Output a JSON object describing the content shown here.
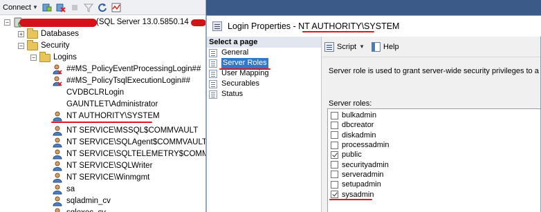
{
  "object_explorer": {
    "toolbar": {
      "connect_label": "Connect",
      "icons": [
        "connect-database-icon",
        "disconnect-icon",
        "stop-icon",
        "filter-icon",
        "refresh-icon",
        "activity-monitor-icon"
      ]
    },
    "server_node": {
      "label": "(SQL Server 13.0.5850.14 -",
      "expander": "−",
      "icon": "server-icon",
      "redacted": true
    },
    "databases_node": {
      "label": "Databases",
      "expander": "+"
    },
    "security_node": {
      "label": "Security",
      "expander": "−"
    },
    "logins_node": {
      "label": "Logins",
      "expander": "−"
    },
    "logins": [
      {
        "name": "##MS_PolicyEventProcessingLogin##",
        "icon": "disabled-login-icon"
      },
      {
        "name": "##MS_PolicyTsqlExecutionLogin##",
        "icon": "disabled-login-icon"
      },
      {
        "name": "CVDBCLRLogin",
        "icon": "none"
      },
      {
        "name": "GAUNTLET\\Administrator",
        "icon": "none"
      },
      {
        "name": "NT AUTHORITY\\SYSTEM",
        "icon": "login-icon"
      },
      {
        "name": "NT SERVICE\\MSSQL$COMMVAULT",
        "icon": "login-icon"
      },
      {
        "name": "NT SERVICE\\SQLAgent$COMMVAULT",
        "icon": "login-icon"
      },
      {
        "name": "NT SERVICE\\SQLTELEMETRY$COMMVAU",
        "icon": "login-icon"
      },
      {
        "name": "NT SERVICE\\SQLWriter",
        "icon": "login-icon"
      },
      {
        "name": "NT SERVICE\\Winmgmt",
        "icon": "login-icon"
      },
      {
        "name": "sa",
        "icon": "login-icon"
      },
      {
        "name": "sqladmin_cv",
        "icon": "login-icon"
      },
      {
        "name": "sqlexec_cv",
        "icon": "login-icon"
      }
    ]
  },
  "dialog": {
    "title": "Login Properties - NT AUTHORITY\\SYSTEM",
    "select_page_header": "Select a page",
    "pages": [
      {
        "label": "General",
        "selected": false
      },
      {
        "label": "Server Roles",
        "selected": true
      },
      {
        "label": "User Mapping",
        "selected": false
      },
      {
        "label": "Securables",
        "selected": false
      },
      {
        "label": "Status",
        "selected": false
      }
    ],
    "toolbar": {
      "script_label": "Script",
      "help_label": "Help"
    },
    "description": "Server role is used to grant server-wide security privileges to a user.",
    "roles_label": "Server roles:",
    "roles": [
      {
        "name": "bulkadmin",
        "checked": false
      },
      {
        "name": "dbcreator",
        "checked": false
      },
      {
        "name": "diskadmin",
        "checked": false
      },
      {
        "name": "processadmin",
        "checked": false
      },
      {
        "name": "public",
        "checked": true
      },
      {
        "name": "securityadmin",
        "checked": false
      },
      {
        "name": "serveradmin",
        "checked": false
      },
      {
        "name": "setupadmin",
        "checked": false
      },
      {
        "name": "sysadmin",
        "checked": true
      }
    ]
  },
  "colors": {
    "selection": "#3178c6",
    "annotation_red": "#e4141b",
    "top_strip": "#3c5a88"
  }
}
